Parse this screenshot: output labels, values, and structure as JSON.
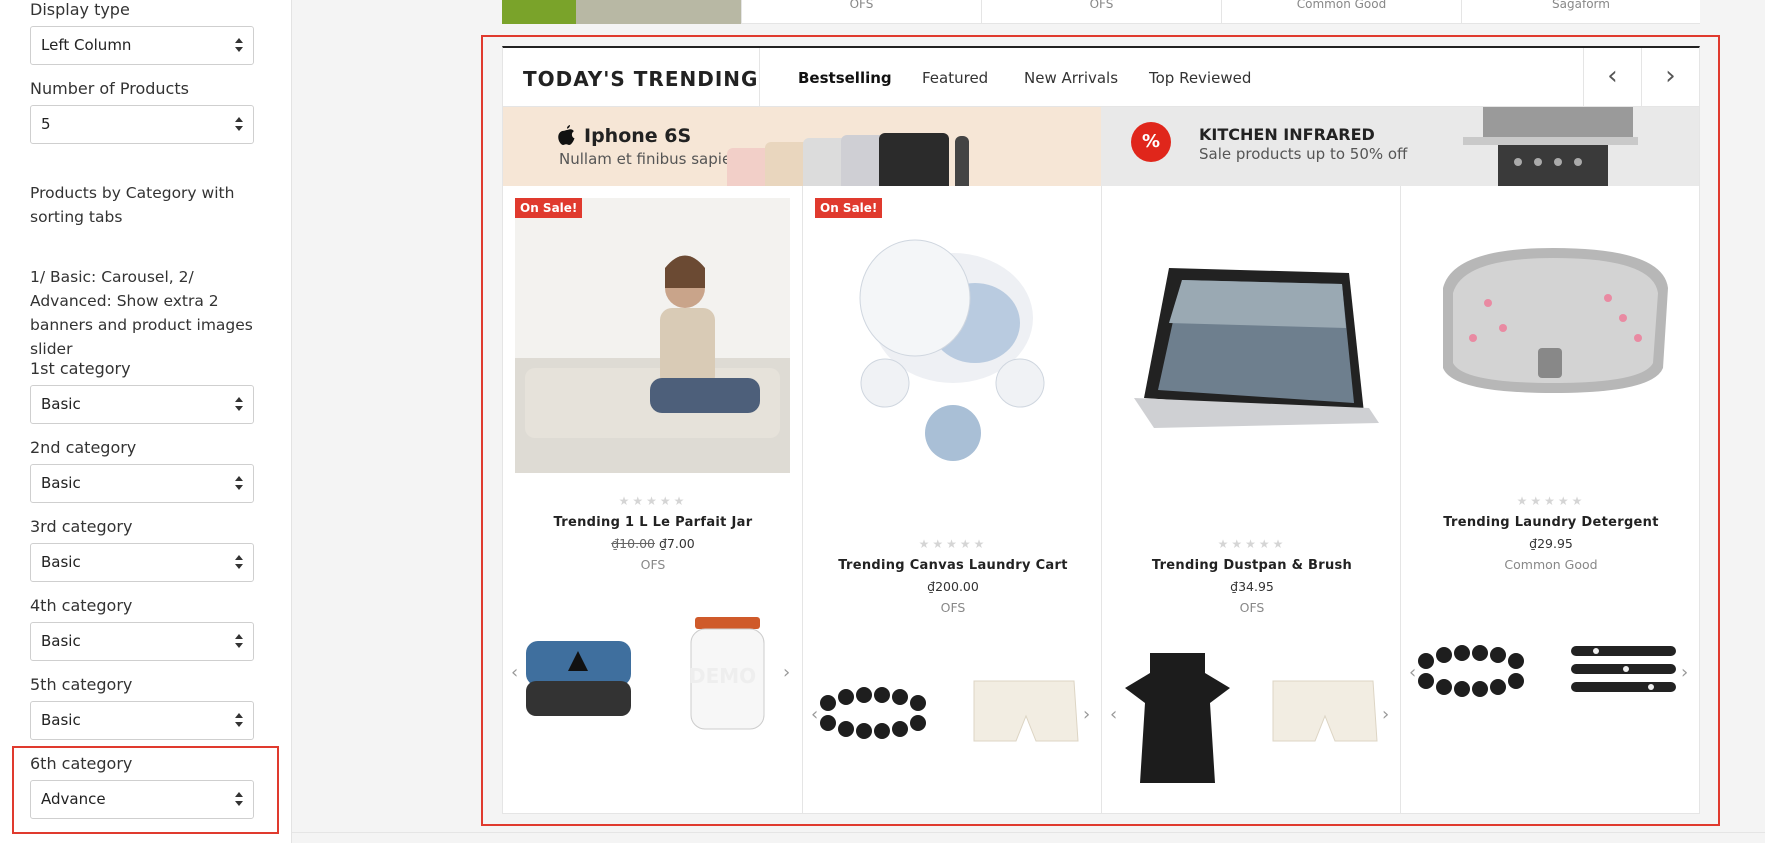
{
  "sidebar": {
    "display_type": {
      "label": "Display type",
      "value": "Left Column"
    },
    "num_products": {
      "label": "Number of Products",
      "value": "5"
    },
    "section_title": "Products by Category with sorting tabs",
    "section_desc": "1/ Basic: Carousel, 2/ Advanced: Show extra 2 banners and product images slider",
    "categories": [
      {
        "label": "1st category",
        "value": "Basic"
      },
      {
        "label": "2nd category",
        "value": "Basic"
      },
      {
        "label": "3rd category",
        "value": "Basic"
      },
      {
        "label": "4th category",
        "value": "Basic"
      },
      {
        "label": "5th category",
        "value": "Basic"
      },
      {
        "label": "6th category",
        "value": "Advance"
      }
    ]
  },
  "top_strip": {
    "cells": [
      "OFS",
      "OFS",
      "Common Good",
      "Sagaform"
    ]
  },
  "module": {
    "title": "TODAY'S TRENDING",
    "tabs": [
      "Bestselling",
      "Featured",
      "New Arrivals",
      "Top Reviewed"
    ],
    "prev_label": "‹",
    "next_label": "›"
  },
  "banners": [
    {
      "title": "Iphone 6S",
      "subtitle": "Nullam et finibus sapien"
    },
    {
      "badge": "%",
      "title": "KITCHEN INFRARED",
      "subtitle": "Sale products up to 50% off"
    }
  ],
  "products": [
    {
      "sale": "On Sale!",
      "stars": "★★★★★",
      "name": "Trending 1 L Le Parfait Jar",
      "old_price": "₫10.00",
      "price": "₫7.00",
      "vendor": "OFS",
      "thumb_text": "DEMO"
    },
    {
      "sale": "On Sale!",
      "stars": "★★★★★",
      "name": "Trending Canvas Laundry Cart",
      "old_price": "",
      "price": "₫200.00",
      "vendor": "OFS"
    },
    {
      "sale": "",
      "stars": "★★★★★",
      "name": "Trending Dustpan & Brush",
      "old_price": "",
      "price": "₫34.95",
      "vendor": "OFS"
    },
    {
      "sale": "",
      "stars": "★★★★★",
      "name": "Trending Laundry Detergent",
      "old_price": "",
      "price": "₫29.95",
      "vendor": "Common Good"
    }
  ],
  "colors": {
    "accent": "#e03a2e",
    "sale_badge": "#e03a2e"
  }
}
